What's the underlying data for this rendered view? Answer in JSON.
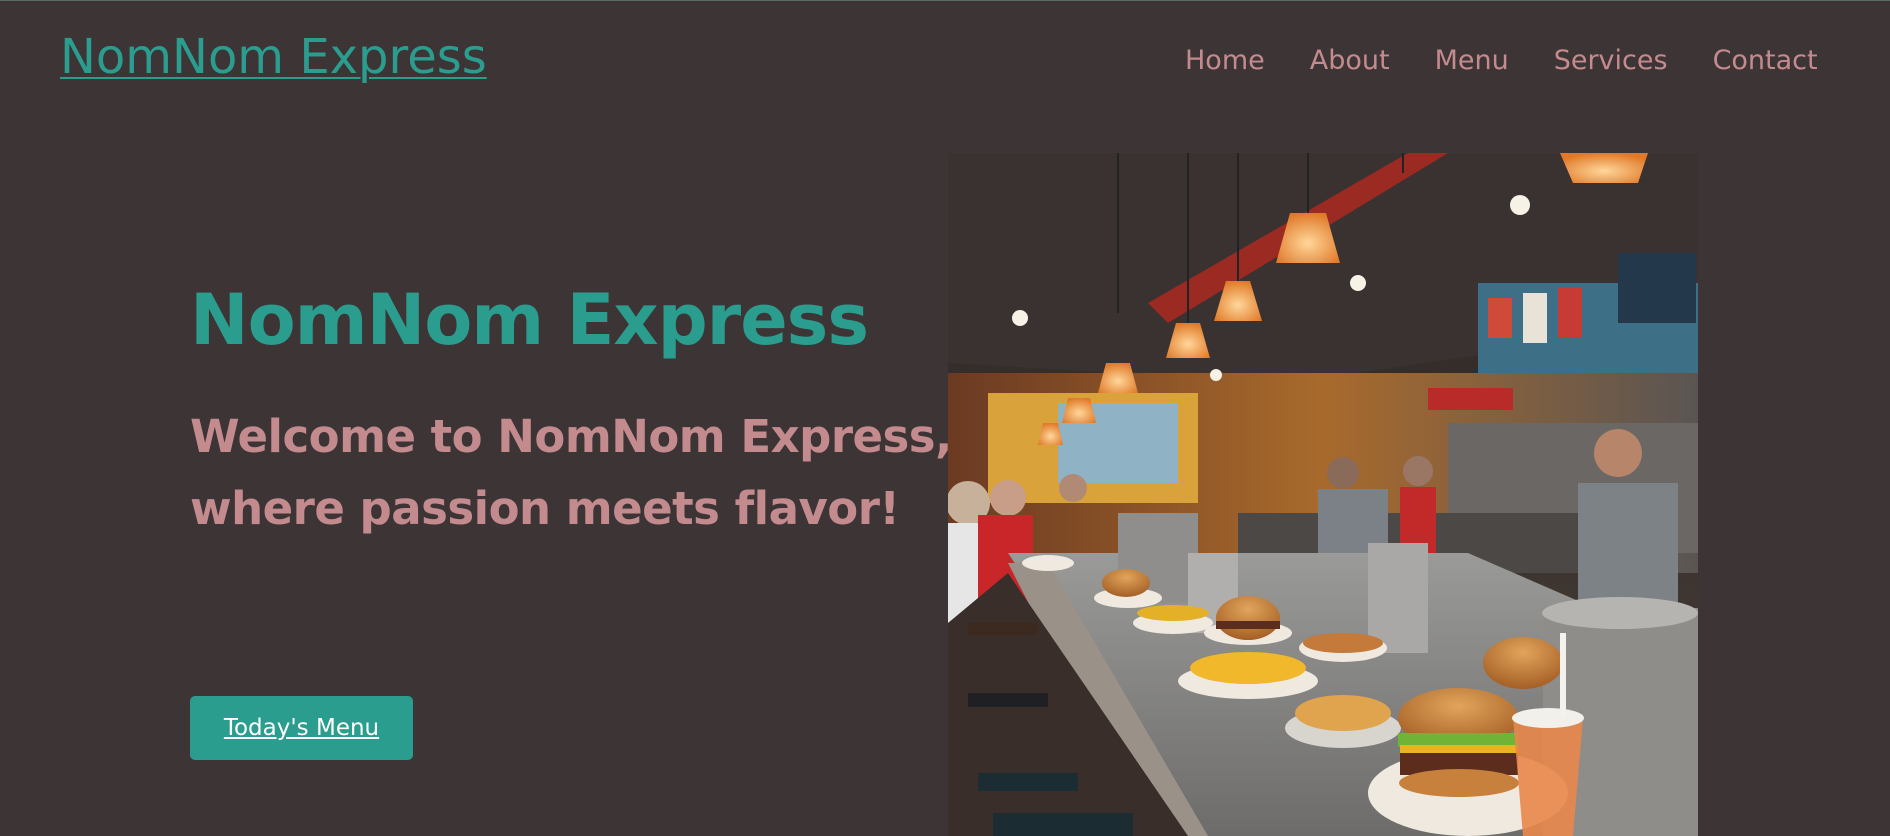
{
  "header": {
    "brand": "NomNom Express",
    "nav": [
      "Home",
      "About",
      "Menu",
      "Services",
      "Contact"
    ]
  },
  "hero": {
    "title": "NomNom Express",
    "subtitle": "Welcome to NomNom Express, where passion meets flavor!",
    "cta_label": "Today's Menu",
    "image_icon": "restaurant-counter-photo"
  },
  "colors": {
    "background": "#3d3435",
    "accent": "#2a9d8f",
    "pink": "#c48b8f"
  }
}
